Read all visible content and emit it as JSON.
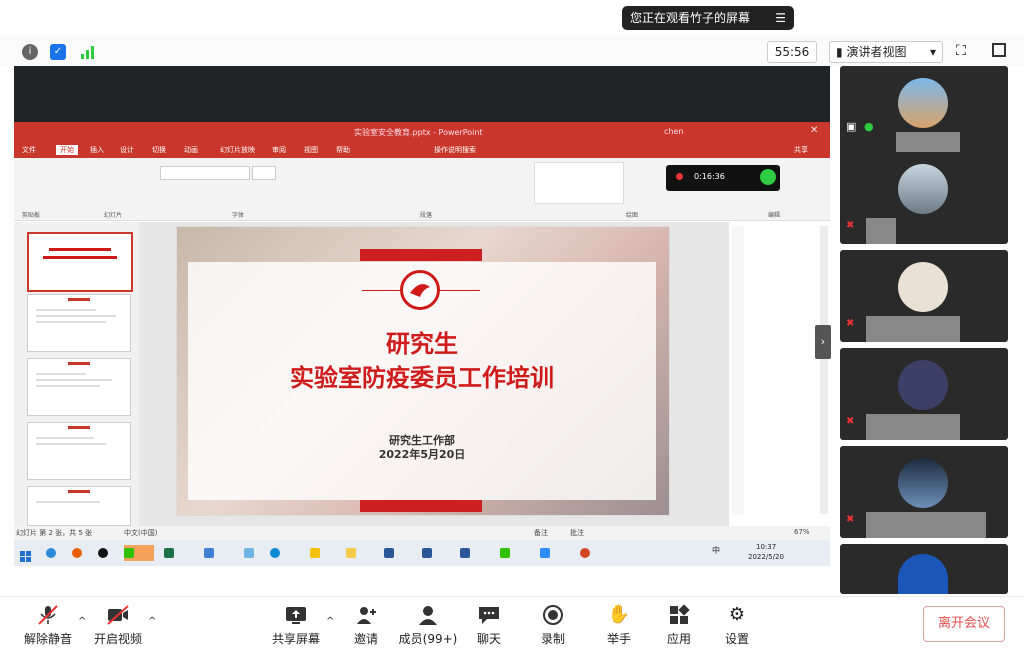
{
  "banner": {
    "text": "您正在观看竹子的屏幕",
    "menu_icon": "menu-icon"
  },
  "topbar": {
    "timer": "55:56",
    "view_label": "演讲者视图",
    "view_caret": "▾"
  },
  "powerpoint": {
    "title": "实验室安全教育.pptx - PowerPoint",
    "user": "chen",
    "tabs": [
      "文件",
      "开始",
      "插入",
      "设计",
      "切换",
      "动画",
      "幻灯片放映",
      "审阅",
      "视图",
      "帮助",
      "操作说明搜索"
    ],
    "share": "共享",
    "groups": [
      "剪贴板",
      "幻灯片",
      "字体",
      "段落",
      "绘图",
      "编辑"
    ],
    "record_time": "0:16:36",
    "slide": {
      "title1": "研究生",
      "title2": "实验室防疫委员工作培训",
      "org": "研究生工作部",
      "date": "2022年5月20日"
    },
    "status": {
      "left": "幻灯片 第 2 张，共 5 张",
      "lang": "中文(中国)",
      "notes": "备注",
      "comments": "批注",
      "zoom": "67%"
    },
    "taskbar": {
      "time": "10:37",
      "date": "2022/5/20",
      "ime": "中"
    }
  },
  "toolbar": {
    "unmute": "解除静音",
    "video": "开启视频",
    "share": "共享屏幕",
    "invite": "邀请",
    "participants": "成员(99+)",
    "chat": "聊天",
    "record": "录制",
    "raise": "举手",
    "apps": "应用",
    "settings": "设置",
    "leave": "离开会议"
  },
  "colors": {
    "accent": "#c9372c",
    "leave": "#e34d4d",
    "slide_red": "#d01b1b"
  }
}
